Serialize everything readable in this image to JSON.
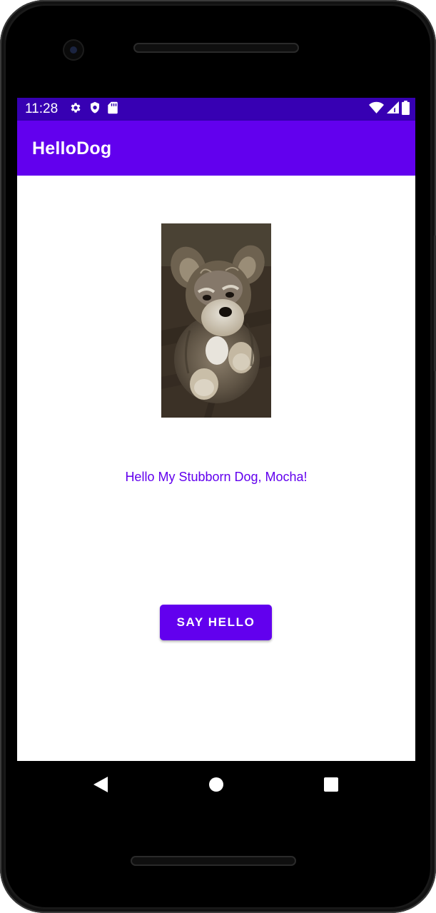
{
  "status_bar": {
    "time": "11:28",
    "left_icons": [
      "gear-icon",
      "shield-icon",
      "sd-card-icon"
    ],
    "right_icons": [
      "wifi-icon",
      "signal-icon",
      "battery-icon"
    ],
    "color": "#3700b3"
  },
  "app_bar": {
    "title": "HelloDog",
    "color": "#6200ee"
  },
  "main": {
    "image": "dog-photo",
    "greeting": "Hello My Stubborn Dog, Mocha!",
    "say_hello_label": "SAY HELLO",
    "accent_color": "#6200ee"
  },
  "nav_bar": {
    "buttons": [
      "back-icon",
      "home-icon",
      "recents-icon"
    ]
  }
}
